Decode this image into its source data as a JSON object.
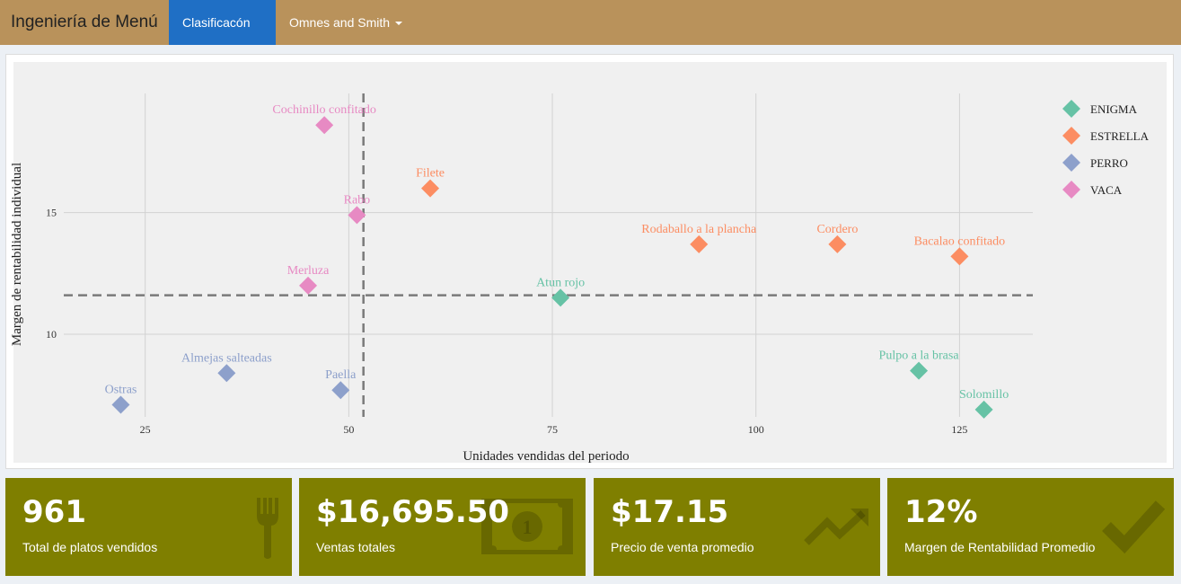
{
  "navbar": {
    "brand": "Ingeniería de Menú",
    "tabs": [
      {
        "label": "Clasificacón",
        "active": true
      },
      {
        "label": "Omnes and Smith",
        "active": false
      }
    ]
  },
  "chart_data": {
    "type": "scatter",
    "xlabel": "Unidades vendidas del periodo",
    "ylabel": "Margen de rentabilidad individual",
    "xticks": [
      25,
      50,
      75,
      100,
      125
    ],
    "yticks": [
      10,
      15
    ],
    "xlim": [
      15,
      134
    ],
    "ylim": [
      6.6,
      19.9
    ],
    "hline": 11.6,
    "vline": 51.8,
    "legend_position": "right",
    "series": [
      {
        "name": "ENIGMA",
        "color": "#66c2a5",
        "points": [
          {
            "label": "Atun rojo",
            "x": 76,
            "y": 11.5
          },
          {
            "label": "Pulpo a la brasa",
            "x": 120,
            "y": 8.5
          },
          {
            "label": "Solomillo",
            "x": 128,
            "y": 6.9
          }
        ]
      },
      {
        "name": "ESTRELLA",
        "color": "#fc8d62",
        "points": [
          {
            "label": "Filete",
            "x": 60,
            "y": 16.0
          },
          {
            "label": "Rodaballo a la plancha",
            "x": 93,
            "y": 13.7
          },
          {
            "label": "Cordero",
            "x": 110,
            "y": 13.7
          },
          {
            "label": "Bacalao confitado",
            "x": 125,
            "y": 13.2
          }
        ]
      },
      {
        "name": "PERRO",
        "color": "#8da0cb",
        "points": [
          {
            "label": "Ostras",
            "x": 22,
            "y": 7.1
          },
          {
            "label": "Almejas salteadas",
            "x": 35,
            "y": 8.4
          },
          {
            "label": "Paella",
            "x": 49,
            "y": 7.7
          }
        ]
      },
      {
        "name": "VACA",
        "color": "#e78ac3",
        "points": [
          {
            "label": "Cochinillo confitado",
            "x": 47,
            "y": 18.6
          },
          {
            "label": "Rabo",
            "x": 51,
            "y": 14.9
          },
          {
            "label": "Merluza",
            "x": 45,
            "y": 12.0
          }
        ]
      }
    ]
  },
  "value_boxes": [
    {
      "value": "961",
      "label": "Total de platos vendidos",
      "icon": "cutlery-icon"
    },
    {
      "value": "$16,695.50",
      "label": "Ventas totales",
      "icon": "money-icon"
    },
    {
      "value": "$17.15",
      "label": "Precio de venta promedio",
      "icon": "trending-up-icon"
    },
    {
      "value": "12%",
      "label": "Margen de Rentabilidad Promedio",
      "icon": "checkmark-icon"
    }
  ],
  "colors": {
    "navbar": "#b9925b",
    "active_tab": "#1f6fc5",
    "value_box": "#7f7f00"
  }
}
